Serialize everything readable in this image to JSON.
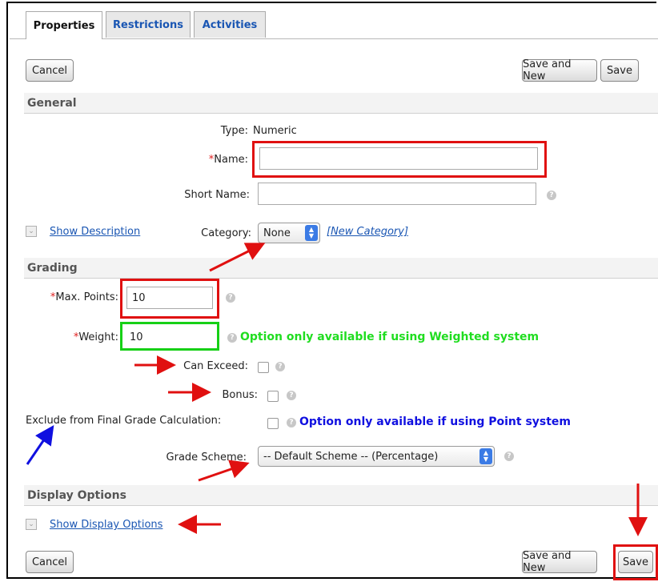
{
  "tabs": [
    {
      "label": "Properties"
    },
    {
      "label": "Restrictions"
    },
    {
      "label": "Activities"
    }
  ],
  "top_buttons": {
    "cancel": "Cancel",
    "save_and_new": "Save and New",
    "save": "Save"
  },
  "general": {
    "title": "General",
    "type_label": "Type:",
    "type_value": "Numeric",
    "name_label": "Name:",
    "name_required": "*",
    "name_value": "",
    "short_name_label": "Short Name:",
    "short_name_value": "",
    "show_description": "Show Description",
    "category_label": "Category:",
    "category_value": "None",
    "new_category": "[New Category]"
  },
  "grading": {
    "title": "Grading",
    "max_points_label": "Max. Points:",
    "max_points_value": "10",
    "weight_label": "Weight:",
    "weight_value": "10",
    "weight_note": "Option only available if using Weighted system",
    "can_exceed_label": "Can Exceed:",
    "bonus_label": "Bonus:",
    "exclude_label": "Exclude from Final Grade Calculation:",
    "exclude_note": "Option only available if using Point system",
    "grade_scheme_label": "Grade Scheme:",
    "grade_scheme_value": "-- Default Scheme -- (Percentage)",
    "required_mark": "*"
  },
  "display": {
    "title": "Display Options",
    "show_display_options": "Show Display Options"
  },
  "bottom_buttons": {
    "cancel": "Cancel",
    "save_and_new": "Save and New",
    "save": "Save"
  },
  "help_glyph": "?",
  "colors": {
    "annotation_red": "#e01010",
    "annotation_green": "#16d016",
    "annotation_blue": "#1010e0",
    "link": "#1a56b3"
  }
}
